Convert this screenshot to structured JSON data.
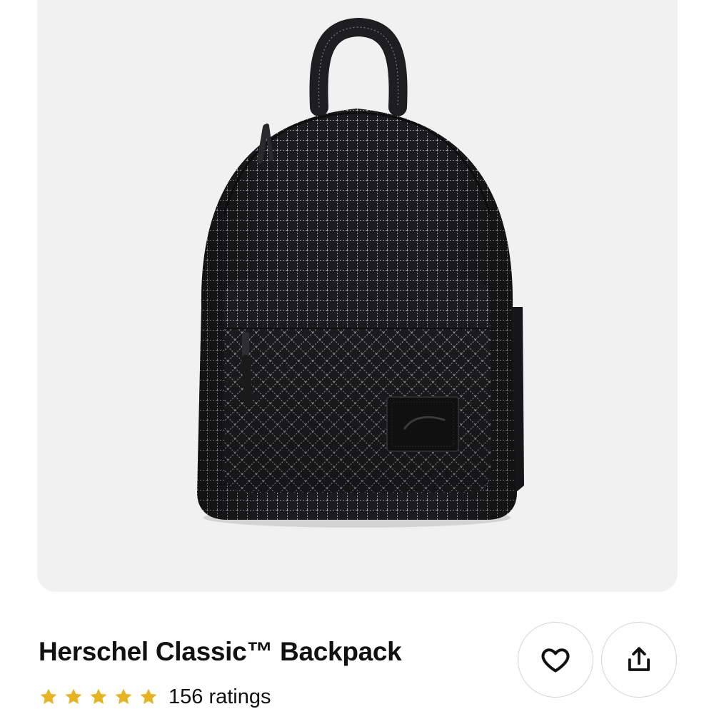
{
  "product": {
    "title": "Herschel Classic™ Backpack",
    "image_alt": "Herschel Classic Backpack in black grid pattern",
    "rating": {
      "stars": 5,
      "max_stars": 5,
      "count_label": "156 ratings"
    }
  },
  "actions": {
    "save_icon": "heart-icon",
    "share_icon": "share-icon"
  },
  "colors": {
    "star": "#e6b422",
    "image_background": "#f1f1f1",
    "text": "#111111",
    "button_border": "#d4d4d4"
  }
}
